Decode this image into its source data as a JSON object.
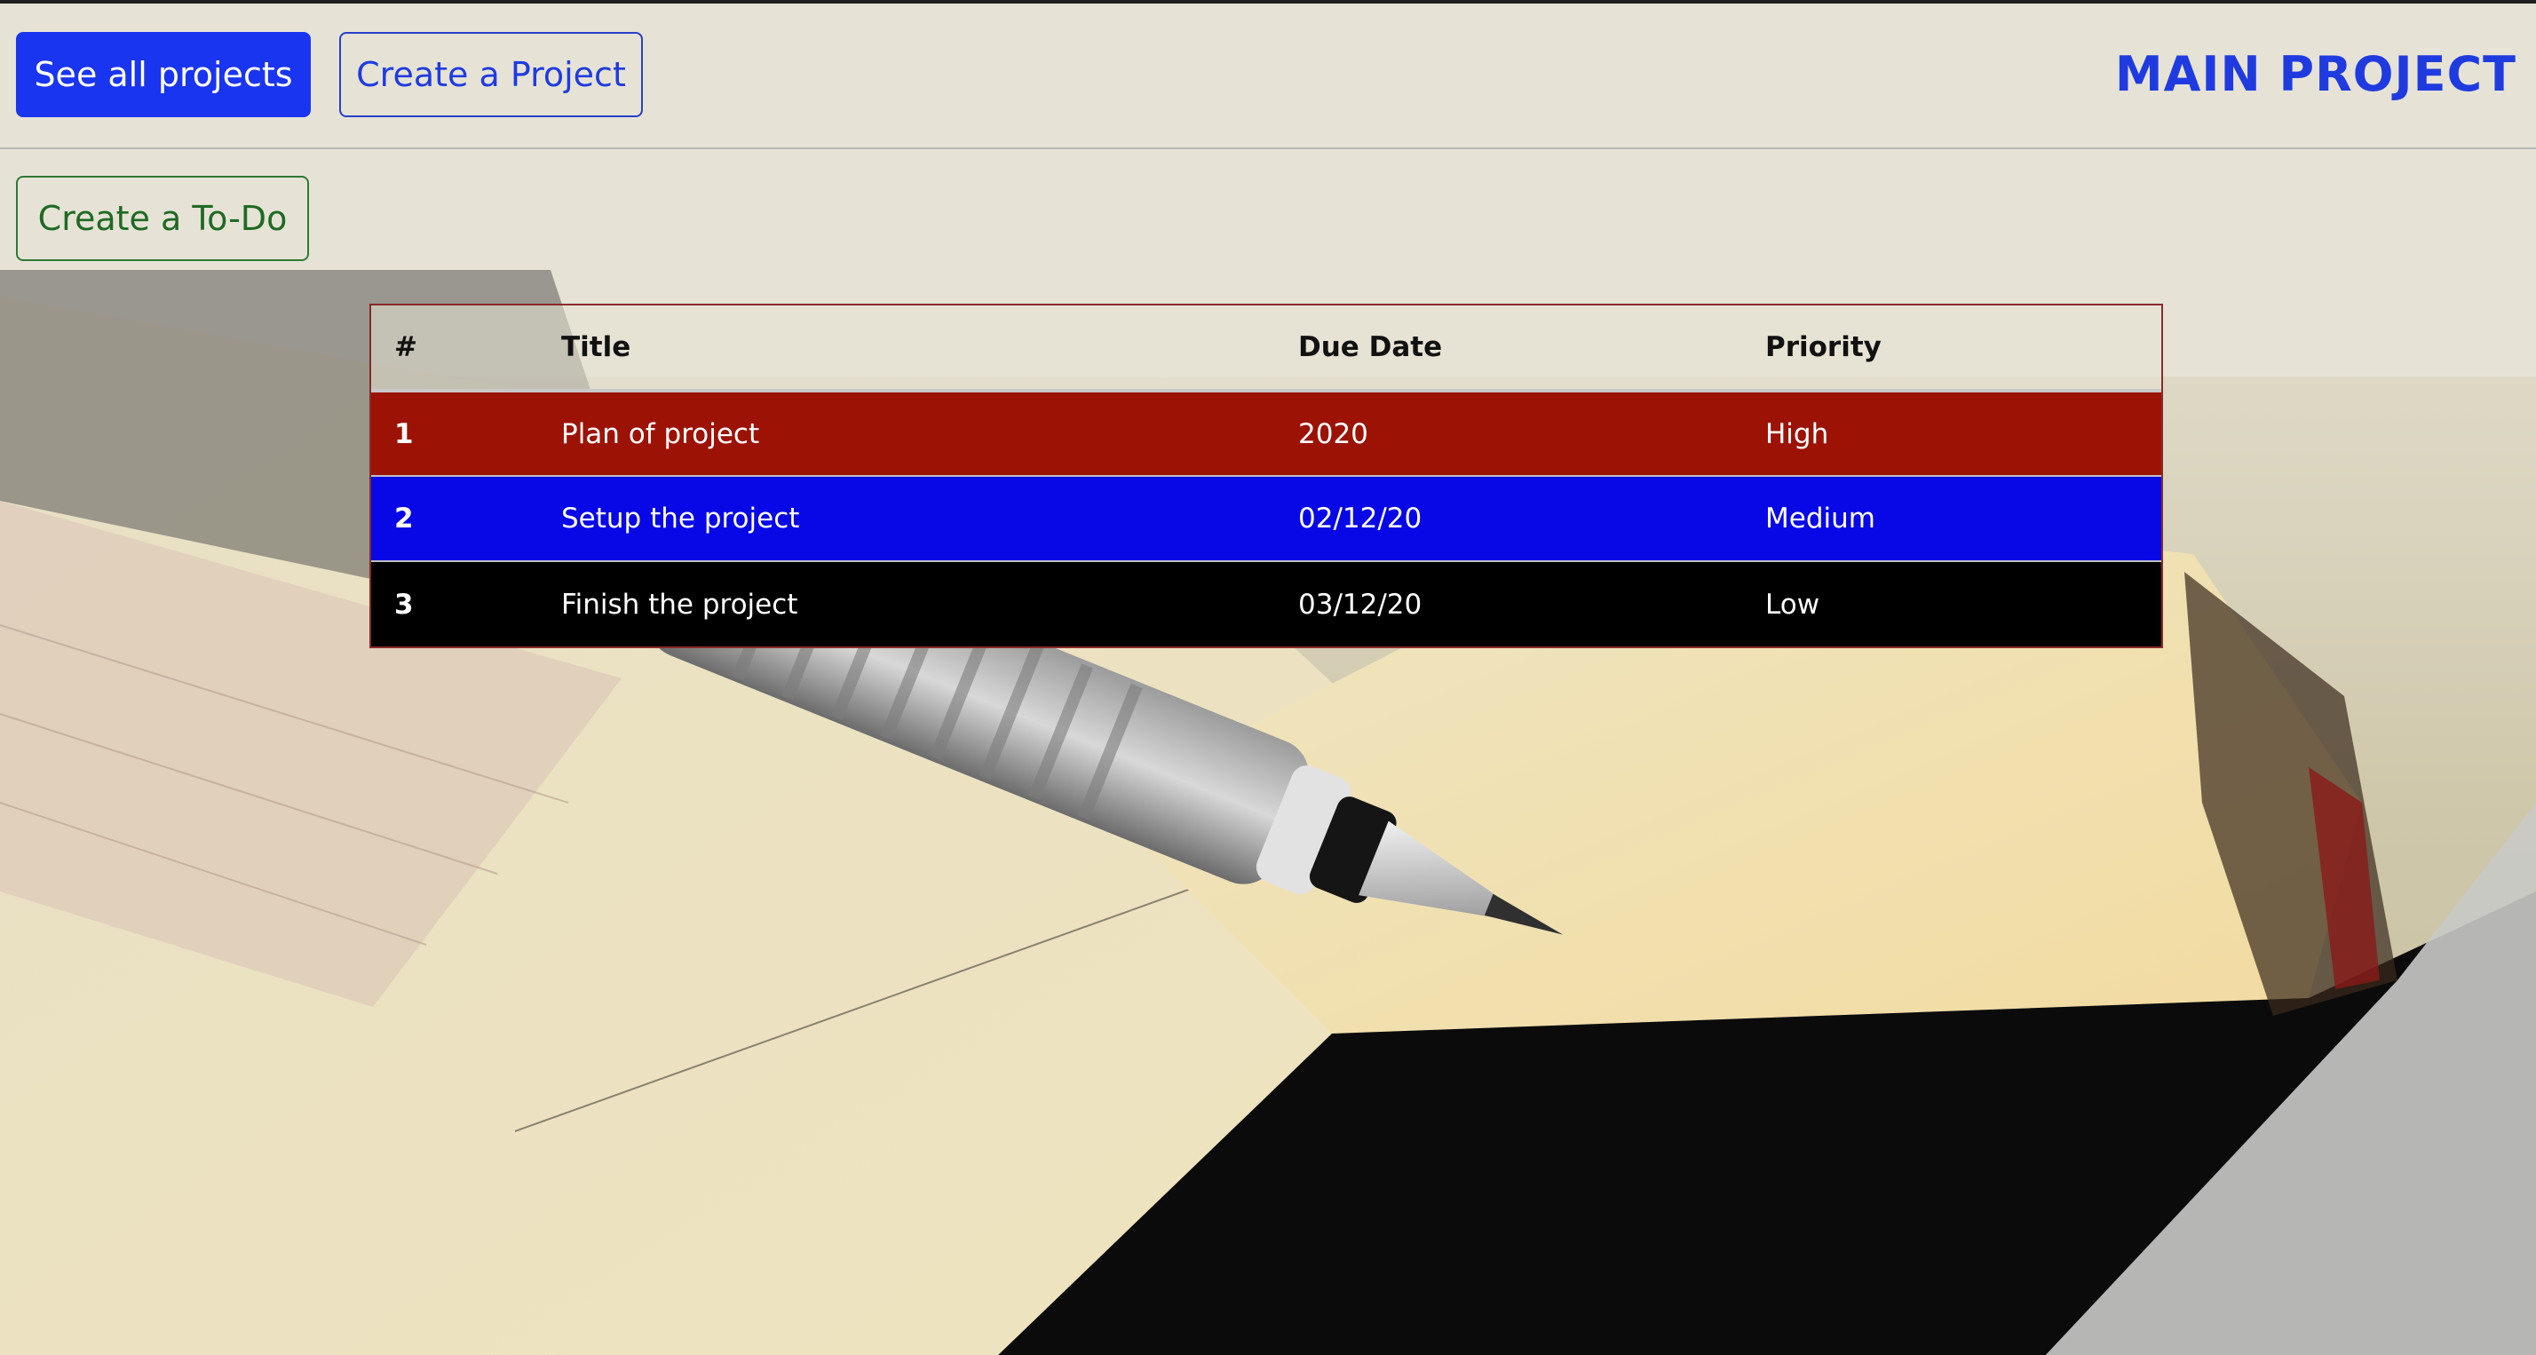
{
  "header": {
    "see_all_label": "See all projects",
    "create_project_label": "Create a Project",
    "brand": "MAIN PROJECT"
  },
  "actions": {
    "create_todo_label": "Create a To-Do"
  },
  "table": {
    "headers": {
      "num": "#",
      "title": "Title",
      "due": "Due Date",
      "priority": "Priority"
    },
    "rows": [
      {
        "num": "1",
        "title": "Plan of project",
        "due": "2020",
        "priority": "High",
        "color": "#9c1306"
      },
      {
        "num": "2",
        "title": "Setup the project",
        "due": "02/12/20",
        "priority": "Medium",
        "color": "#0808e6"
      },
      {
        "num": "3",
        "title": "Finish the project",
        "due": "03/12/20",
        "priority": "Low",
        "color": "#000000"
      }
    ]
  },
  "colors": {
    "primary": "#1a35f0",
    "success": "#1f6a24",
    "high": "#9c1306",
    "medium": "#0808e6",
    "low": "#000000"
  },
  "icons": {
    "background": "notebook-with-fountain-pen-photo"
  }
}
